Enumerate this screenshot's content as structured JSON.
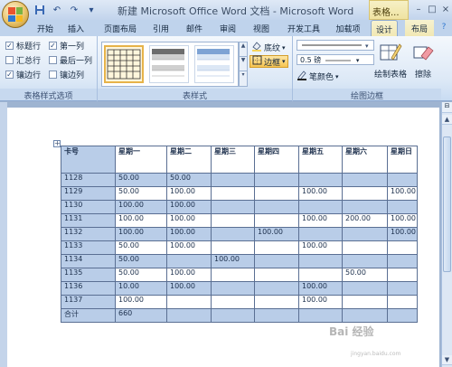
{
  "title": {
    "document": "新建 Microsoft Office Word 文档",
    "separator": " - ",
    "app": "Microsoft Word",
    "context_title": "表格..."
  },
  "tabs": [
    "开始",
    "插入",
    "页面布局",
    "引用",
    "邮件",
    "审阅",
    "视图",
    "开发工具",
    "加载项",
    "设计",
    "布局"
  ],
  "active_tab": "设计",
  "options_group": {
    "label": "表格样式选项",
    "items": [
      {
        "label": "标题行",
        "checked": true
      },
      {
        "label": "第一列",
        "checked": true
      },
      {
        "label": "汇总行",
        "checked": false
      },
      {
        "label": "最后一列",
        "checked": false
      },
      {
        "label": "镶边行",
        "checked": true
      },
      {
        "label": "镶边列",
        "checked": false
      }
    ]
  },
  "styles_group": {
    "label": "表样式",
    "shading": "底纹",
    "border": "边框"
  },
  "draw_group": {
    "label": "绘图边框",
    "weight": "0.5 磅",
    "pen_color": "笔颜色",
    "draw_table": "绘制表格",
    "eraser": "擦除"
  },
  "table": {
    "header": [
      "卡号",
      "星期一",
      "星期二",
      "星期三",
      "星期四",
      "星期五",
      "星期六",
      "星期日"
    ],
    "rows": [
      [
        "1128",
        "50.00",
        "50.00",
        "",
        "",
        "",
        "",
        ""
      ],
      [
        "1129",
        "50.00",
        "100.00",
        "",
        "",
        "100.00",
        "",
        "100.00"
      ],
      [
        "1130",
        "100.00",
        "100.00",
        "",
        "",
        "",
        "",
        ""
      ],
      [
        "1131",
        "100.00",
        "100.00",
        "",
        "",
        "100.00",
        "200.00",
        "100.00"
      ],
      [
        "1132",
        "100.00",
        "100.00",
        "",
        "100.00",
        "",
        "",
        "100.00"
      ],
      [
        "1133",
        "50.00",
        "100.00",
        "",
        "",
        "100.00",
        "",
        ""
      ],
      [
        "1134",
        "50.00",
        "",
        "100.00",
        "",
        "",
        "",
        ""
      ],
      [
        "1135",
        "50.00",
        "100.00",
        "",
        "",
        "",
        "50.00",
        ""
      ],
      [
        "1136",
        "10.00",
        "100.00",
        "",
        "",
        "100.00",
        "",
        ""
      ],
      [
        "1137",
        "100.00",
        "",
        "",
        "",
        "100.00",
        "",
        ""
      ],
      [
        "合计",
        "660",
        "",
        "",
        "",
        "",
        "",
        ""
      ]
    ]
  },
  "watermark": "Bai 经验",
  "watermark_sub": "jingyan.baidu.com",
  "colors": {
    "accent": "#f0c35a",
    "ribbon": "#dce8f6",
    "table_band": "#b9cde8"
  }
}
